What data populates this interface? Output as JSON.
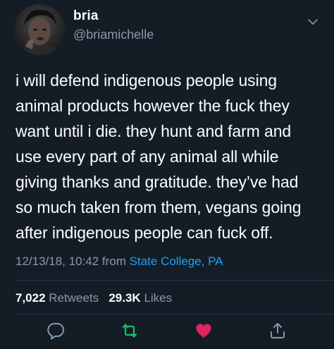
{
  "user": {
    "display_name": "bria",
    "handle": "@briamichelle",
    "avatar_icon": "profile-photo"
  },
  "tweet": {
    "text": "i will defend indigenous people using\nanimal products however the fuck they\nwant until i die. they hunt and farm and\nuse every part of any animal all while\ngiving thanks and gratitude. they’ve had\nso much taken from them, vegans going\nafter indigenous people can fuck off.",
    "timestamp": "12/13/18, 10:42",
    "from_label": "from",
    "location": "State College, PA"
  },
  "stats": {
    "retweets_count": "7,022",
    "retweets_label": "Retweets",
    "likes_count": "29.3K",
    "likes_label": "Likes"
  },
  "actions": {
    "reply_icon": "speech-bubble-icon",
    "retweet_icon": "retweet-icon",
    "like_icon": "heart-icon",
    "share_icon": "share-icon"
  },
  "colors": {
    "background": "#141d26",
    "secondary_text": "#8899a6",
    "link": "#1da1f2",
    "retweet_green": "#17bf63",
    "like_red": "#e0245e"
  }
}
